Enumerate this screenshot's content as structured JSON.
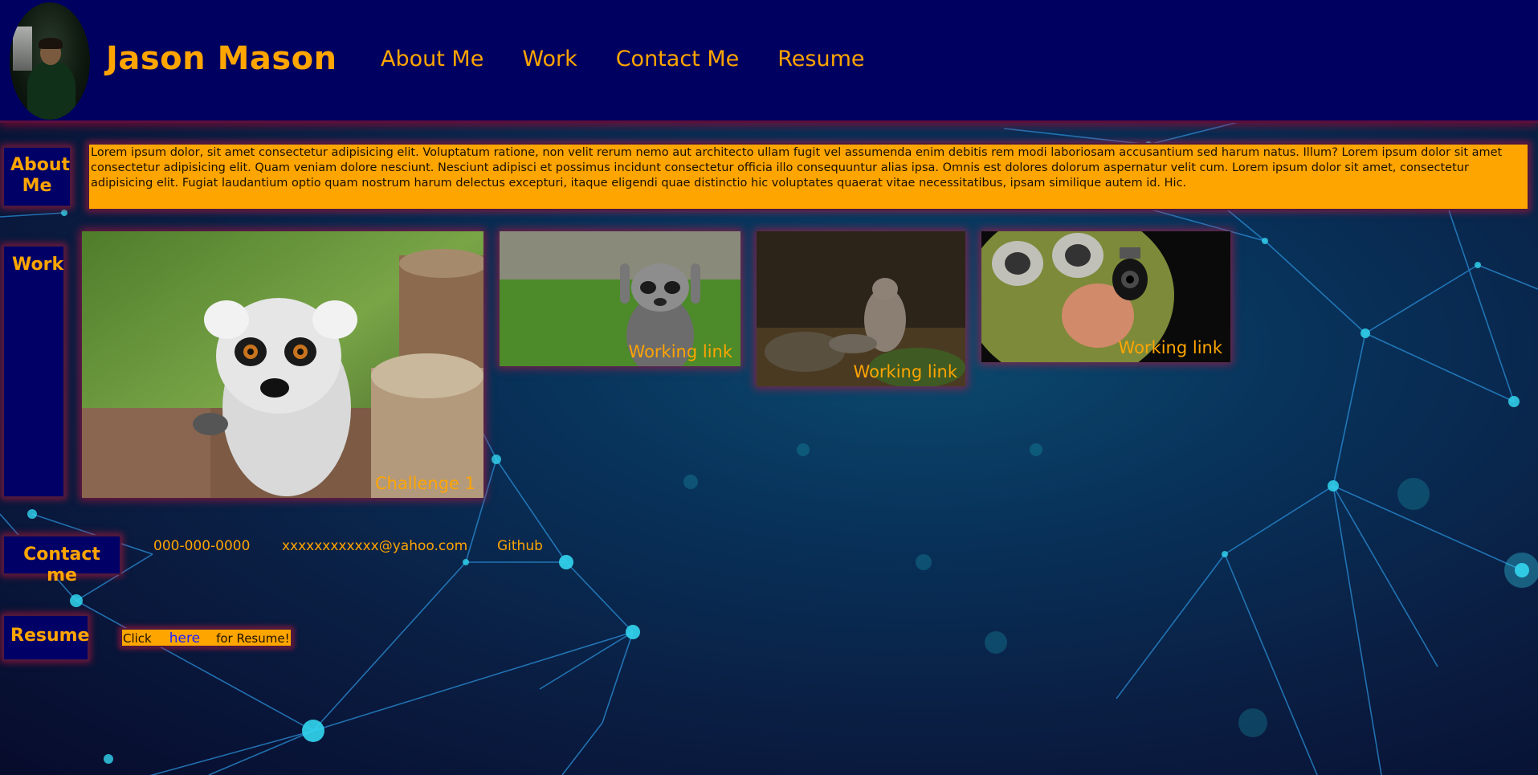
{
  "header": {
    "title": "Jason Mason",
    "nav": [
      "About Me",
      "Work",
      "Contact Me",
      "Resume"
    ]
  },
  "about": {
    "label": "About Me",
    "text": "Lorem ipsum dolor, sit amet consectetur adipisicing elit. Voluptatum ratione, non velit rerum nemo aut architecto ullam fugit vel assumenda enim debitis rem modi laboriosam accusantium sed harum natus. Illum? Lorem ipsum dolor sit amet consectetur adipisicing elit. Quam veniam dolore nesciunt. Nesciunt adipisci et possimus incidunt consectetur officia illo consequuntur alias ipsa. Omnis est dolores dolorum aspernatur velit cum. Lorem ipsum dolor sit amet, consectetur adipisicing elit. Fugiat laudantium optio quam nostrum harum delectus excepturi, itaque eligendi quae distinctio hic voluptates quaerat vitae necessitatibus, ipsam similique autem id. Hic."
  },
  "work": {
    "label": "Work",
    "cards": [
      {
        "caption": "Challenge 1",
        "image": "lemur-photo"
      },
      {
        "caption": "Working link",
        "image": "raccoon-photo"
      },
      {
        "caption": "Working link",
        "image": "squirrel-photo"
      },
      {
        "caption": "Working link",
        "image": "bird-with-gun-meme"
      }
    ]
  },
  "contact": {
    "label": "Contact me",
    "phone": "000-000-0000",
    "email": "xxxxxxxxxxxx@yahoo.com",
    "github": "Github"
  },
  "resume": {
    "label": "Resume",
    "prefix": "Click",
    "link": "here",
    "suffix": "for Resume!"
  },
  "colors": {
    "header_bg": "#000060",
    "accent": "#ffa500",
    "label_bg": "#000066",
    "glow": "#c8143c"
  }
}
